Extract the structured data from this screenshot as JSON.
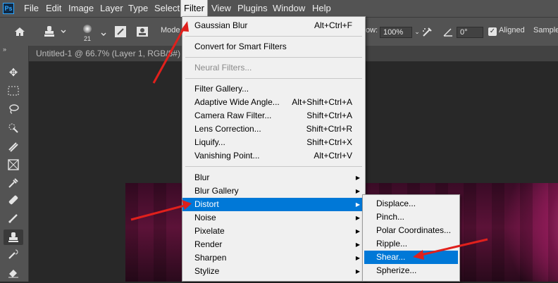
{
  "app": {
    "logo": "Ps"
  },
  "menubar": {
    "items": [
      {
        "label": "File"
      },
      {
        "label": "Edit"
      },
      {
        "label": "Image"
      },
      {
        "label": "Layer"
      },
      {
        "label": "Type"
      },
      {
        "label": "Select"
      },
      {
        "label": "Filter"
      },
      {
        "label": "View"
      },
      {
        "label": "Plugins"
      },
      {
        "label": "Window"
      },
      {
        "label": "Help"
      }
    ],
    "active": "Filter"
  },
  "options_bar": {
    "brush_size": "21",
    "mode_label": "Mode",
    "flow_label": "ow:",
    "flow_value": "100%",
    "angle_value": "0°",
    "aligned_label": "Aligned",
    "sample_label": "Samples"
  },
  "document": {
    "tab_title": "Untitled-1 @ 66.7% (Layer 1, RGB/8#)"
  },
  "filter_menu": {
    "items": [
      {
        "label": "Gaussian Blur",
        "shortcut": "Alt+Ctrl+F"
      },
      {
        "label": "Convert for Smart Filters"
      },
      {
        "label": "Neural Filters..."
      },
      {
        "label": "Filter Gallery..."
      },
      {
        "label": "Adaptive Wide Angle...",
        "shortcut": "Alt+Shift+Ctrl+A"
      },
      {
        "label": "Camera Raw Filter...",
        "shortcut": "Shift+Ctrl+A"
      },
      {
        "label": "Lens Correction...",
        "shortcut": "Shift+Ctrl+R"
      },
      {
        "label": "Liquify...",
        "shortcut": "Shift+Ctrl+X"
      },
      {
        "label": "Vanishing Point...",
        "shortcut": "Alt+Ctrl+V"
      },
      {
        "label": "Blur"
      },
      {
        "label": "Blur Gallery"
      },
      {
        "label": "Distort"
      },
      {
        "label": "Noise"
      },
      {
        "label": "Pixelate"
      },
      {
        "label": "Render"
      },
      {
        "label": "Sharpen"
      },
      {
        "label": "Stylize"
      }
    ],
    "selected": "Distort"
  },
  "distort_submenu": {
    "items": [
      {
        "label": "Displace..."
      },
      {
        "label": "Pinch..."
      },
      {
        "label": "Polar Coordinates..."
      },
      {
        "label": "Ripple..."
      },
      {
        "label": "Shear..."
      },
      {
        "label": "Spherize..."
      }
    ],
    "selected": "Shear..."
  },
  "colors": {
    "menubar_bg": "#535353",
    "menu_bg": "#f0f0f0",
    "highlight": "#0078d7",
    "annotation_arrow": "#e0201c"
  }
}
